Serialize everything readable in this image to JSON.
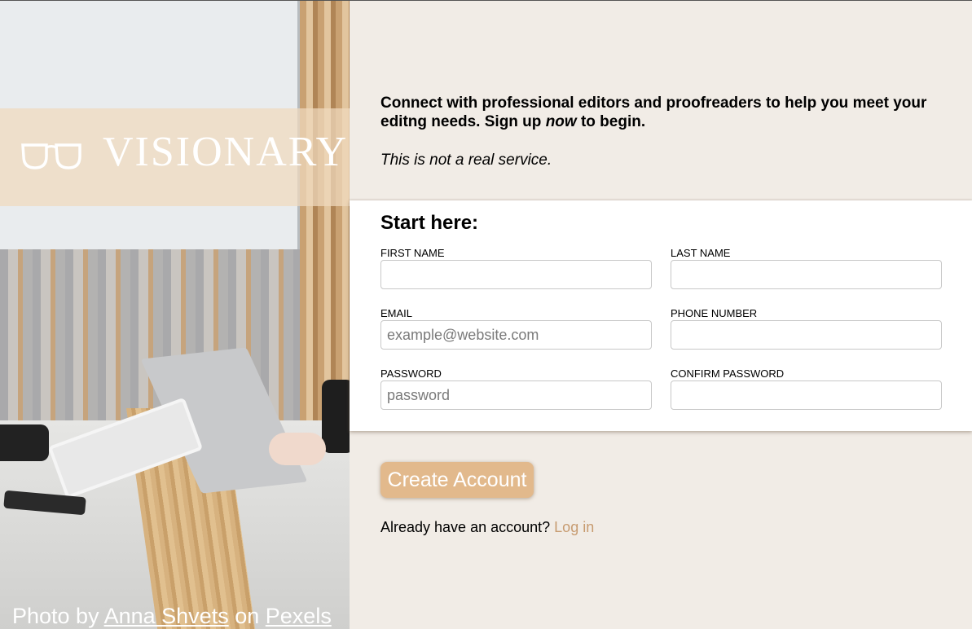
{
  "brand": {
    "name": "VISIONARY",
    "glasses_icon": "glasses-icon",
    "logo_color": "#ffffff"
  },
  "photo_credit": {
    "prefix": "Photo by",
    "author": "Anna Shvets",
    "middle": "on",
    "site": "Pexels"
  },
  "intro": {
    "text_before": "Connect with professional editors and proofreaders to help you meet your editng needs. Sign up ",
    "text_em": "now",
    "text_after": " to begin.",
    "disclaimer": "This is not a real service."
  },
  "form": {
    "title": "Start here:",
    "first_name": {
      "label": "FIRST NAME",
      "value": "",
      "placeholder": ""
    },
    "last_name": {
      "label": "LAST NAME",
      "value": "",
      "placeholder": ""
    },
    "email": {
      "label": "EMAIL",
      "value": "",
      "placeholder": "example@website.com"
    },
    "phone": {
      "label": "PHONE NUMBER",
      "value": "",
      "placeholder": ""
    },
    "password": {
      "label": "PASSWORD",
      "value": "",
      "placeholder": "password"
    },
    "confirm_password": {
      "label": "CONFIRM PASSWORD",
      "value": "",
      "placeholder": ""
    }
  },
  "actions": {
    "create_label": "Create Account",
    "login_prompt": "Already have an account?",
    "login_link": "Log in"
  },
  "colors": {
    "page_bg": "#f1ece6",
    "accent": "#e2b98c",
    "link": "#c79b70",
    "logo_band": "#f0dabe"
  }
}
